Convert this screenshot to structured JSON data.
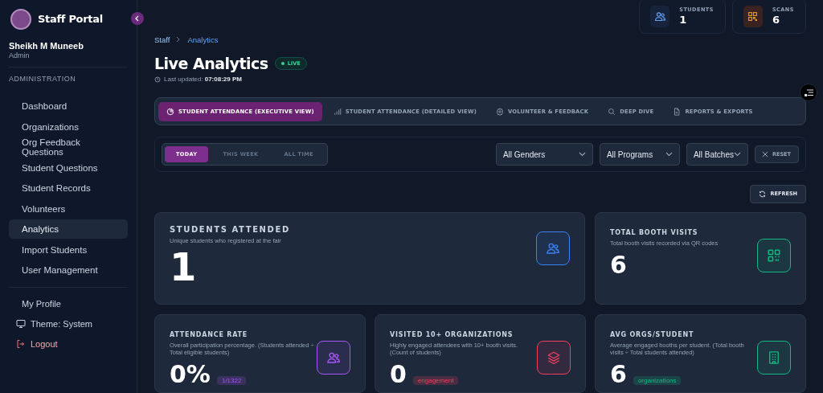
{
  "sidebar": {
    "brand": "Staff Portal",
    "user": {
      "name": "Sheikh M Muneeb",
      "role": "Admin"
    },
    "section": "ADMINISTRATION",
    "items": [
      {
        "label": "Dashboard",
        "selected": false
      },
      {
        "label": "Organizations",
        "selected": false
      },
      {
        "label": "Org Feedback Questions",
        "selected": false
      },
      {
        "label": "Student Questions",
        "selected": false
      },
      {
        "label": "Student Records",
        "selected": false
      },
      {
        "label": "Volunteers",
        "selected": false
      },
      {
        "label": "Analytics",
        "selected": true
      },
      {
        "label": "Import Students",
        "selected": false
      },
      {
        "label": "User Management",
        "selected": false
      }
    ],
    "footer_items": [
      {
        "label": "My Profile",
        "kind": "link"
      },
      {
        "label": "Theme: System",
        "kind": "theme"
      },
      {
        "label": "Logout",
        "kind": "logout"
      }
    ]
  },
  "breadcrumb": [
    "Staff",
    "Analytics"
  ],
  "header": {
    "title": "Live Analytics",
    "live_badge": "LIVE",
    "updated_label": "Last updated:",
    "updated_time": "07:08:29 PM"
  },
  "summary": [
    {
      "label": "STUDENTS",
      "value": "1",
      "kind": "students"
    },
    {
      "label": "SCANS",
      "value": "6",
      "kind": "scans"
    }
  ],
  "tabs": [
    {
      "label": "STUDENT ATTENDANCE (EXECUTIVE VIEW)",
      "kind": "pie",
      "selected": true
    },
    {
      "label": "STUDENT ATTENDANCE (DETAILED VIEW)",
      "kind": "bars",
      "selected": false
    },
    {
      "label": "VOLUNTEER & FEEDBACK",
      "kind": "gear",
      "selected": false
    },
    {
      "label": "DEEP DIVE",
      "kind": "search",
      "selected": false
    },
    {
      "label": "REPORTS & EXPORTS",
      "kind": "file",
      "selected": false
    }
  ],
  "periods": [
    {
      "label": "TODAY",
      "selected": true
    },
    {
      "label": "THIS WEEK",
      "selected": false
    },
    {
      "label": "ALL TIME",
      "selected": false
    }
  ],
  "filters": [
    {
      "value": "All Genders"
    },
    {
      "value": "All Programs"
    },
    {
      "value": "All Batches"
    }
  ],
  "reset": "RESET",
  "refresh": "REFRESH",
  "metrics": [
    {
      "title": "STUDENTS ATTENDED",
      "subtitle": "Unique students who registered at the fair",
      "value": "1",
      "kind": "students",
      "color": "#3b82f6"
    },
    {
      "title": "TOTAL BOOTH VISITS",
      "subtitle": "Total booth visits recorded via QR codes",
      "value": "6",
      "kind": "qr",
      "color": "#10b981"
    },
    {
      "title": "ATTENDANCE RATE",
      "subtitle": "Overall participation percentage. (Students attended ÷ Total eligible students)",
      "value": "0%",
      "badge": "1/1322",
      "kind": "students",
      "color": "#a855f7"
    },
    {
      "title": "VISITED 10+ ORGANIZATIONS",
      "subtitle": "Highly engaged attendees with 10+ booth visits. (Count of students)",
      "value": "0",
      "badge": "engagement",
      "kind": "layers",
      "color": "#f43f5e"
    },
    {
      "title": "AVG ORGS/STUDENT",
      "subtitle": "Average engaged booths per student. (Total booth visits ÷ Total students attended)",
      "value": "6",
      "badge": "organizations",
      "kind": "building",
      "color": "#10b981"
    }
  ]
}
